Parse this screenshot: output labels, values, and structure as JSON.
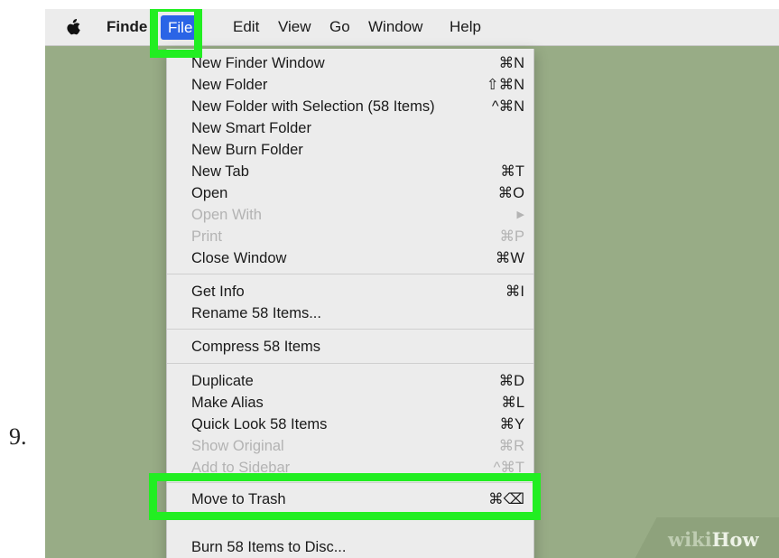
{
  "step_number": "9.",
  "menubar": {
    "apple_icon": "apple-logo-icon",
    "items": [
      {
        "label": "Finde"
      },
      {
        "label": "File",
        "selected": true
      },
      {
        "label": "Edit"
      },
      {
        "label": "View"
      },
      {
        "label": "Go"
      },
      {
        "label": "Window"
      },
      {
        "label": "Help"
      }
    ]
  },
  "menu": {
    "items": [
      {
        "label": "New Finder Window",
        "shortcut": "⌘N"
      },
      {
        "label": "New Folder",
        "shortcut": "⇧⌘N"
      },
      {
        "label": "New Folder with Selection (58 Items)",
        "shortcut": "^⌘N"
      },
      {
        "label": "New Smart Folder",
        "shortcut": ""
      },
      {
        "label": "New Burn Folder",
        "shortcut": ""
      },
      {
        "label": "New Tab",
        "shortcut": "⌘T"
      },
      {
        "label": "Open",
        "shortcut": "⌘O"
      },
      {
        "label": "Open With",
        "shortcut": "▶",
        "disabled": true
      },
      {
        "label": "Print",
        "shortcut": "⌘P",
        "disabled": true
      },
      {
        "label": "Close Window",
        "shortcut": "⌘W"
      },
      {
        "label": "Get Info",
        "shortcut": "⌘I"
      },
      {
        "label": "Rename 58 Items...",
        "shortcut": ""
      },
      {
        "label": "Compress 58 Items",
        "shortcut": ""
      },
      {
        "label": "Duplicate",
        "shortcut": "⌘D"
      },
      {
        "label": "Make Alias",
        "shortcut": "⌘L"
      },
      {
        "label": "Quick Look 58 Items",
        "shortcut": "⌘Y"
      },
      {
        "label": "Show Original",
        "shortcut": "⌘R",
        "disabled": true
      },
      {
        "label": "Add to Sidebar",
        "shortcut": "^⌘T",
        "disabled": true
      },
      {
        "label": "Move to Trash",
        "shortcut": "⌘⌫",
        "highlighted": true
      },
      {
        "label": "Burn 58 Items to Disc...",
        "shortcut": ""
      }
    ]
  },
  "watermark": {
    "part1": "wiki",
    "part2": "How"
  },
  "colors": {
    "desktop": "#98ac86",
    "menubar": "#ececec",
    "selected_menu": "#2a64e6",
    "highlight_box": "#22ee22",
    "disabled_text": "#b3b3b3"
  }
}
